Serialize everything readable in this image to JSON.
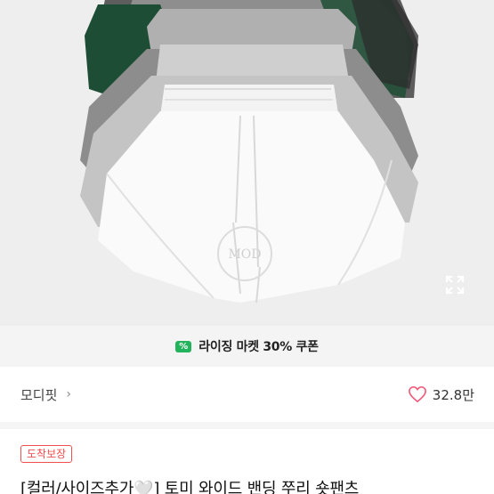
{
  "coupon": {
    "label": "라이징 마켓 30% 쿠폰",
    "icon": "coupon-icon",
    "icon_glyph": "%",
    "color": "#23b35c"
  },
  "shop": {
    "name": "모디핏",
    "chevron": "›"
  },
  "likes": {
    "count": "32.8만",
    "icon": "heart-outline-icon",
    "color": "#f05a79"
  },
  "badge": {
    "label": "도착보장",
    "color": "#f04f4f"
  },
  "product": {
    "title": "[컬러/사이즈추가🤍] 토미 와이드 밴딩 쭈리 숏팬츠",
    "image_watermark": "M O D"
  },
  "image_controls": {
    "expand_icon": "expand-icon"
  }
}
